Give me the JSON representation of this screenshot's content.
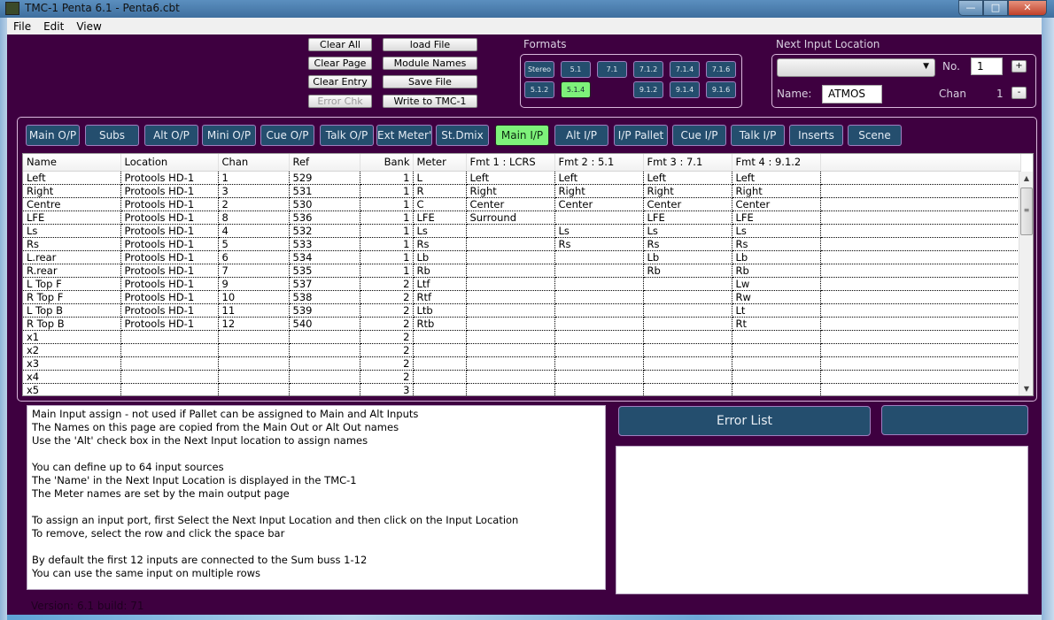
{
  "window": {
    "title": "TMC-1 Penta 6.1 - Penta6.cbt",
    "controls": {
      "minimize": "—",
      "maximize": "□",
      "close": "✕"
    }
  },
  "menu": [
    "File",
    "Edit",
    "View"
  ],
  "actions_left": {
    "clear_all": "Clear All",
    "clear_page": "Clear Page",
    "clear_entry": "Clear Entry",
    "error_chk": "Error Chk"
  },
  "actions_right": {
    "load_file": "load File",
    "module_names": "Module Names",
    "save_file": "Save File",
    "write_tmc": "Write to TMC-1"
  },
  "formats": {
    "label": "Formats",
    "row1": [
      "Stereo",
      "5.1",
      "7.1",
      "7.1.2",
      "7.1.4",
      "7.1.6"
    ],
    "row2": [
      "5.1.2",
      "5.1.4",
      "",
      "9.1.2",
      "9.1.4",
      "9.1.6"
    ],
    "active": "5.1.4"
  },
  "next_input": {
    "label": "Next Input Location",
    "location_value": "",
    "no_label": "No.",
    "no_value": "1",
    "plus": "+",
    "name_label": "Name:",
    "name_value": "ATMOS",
    "chan_label": "Chan",
    "chan_value": "1",
    "minus": "-"
  },
  "tabs": [
    "Main O/P",
    "Subs",
    "Alt O/P",
    "Mini O/P",
    "Cue O/P",
    "Talk O/P",
    "Ext Meter's",
    "St.Dmix",
    "Main I/P",
    "Alt I/P",
    "I/P Pallet",
    "Cue I/P",
    "Talk I/P",
    "Inserts",
    "Scene"
  ],
  "active_tab": "Main I/P",
  "grid": {
    "columns": [
      "Name",
      "Location",
      "Chan",
      "Ref",
      "Bank",
      "Meter",
      "Fmt 1 : LCRS",
      "Fmt 2 : 5.1",
      "Fmt 3 : 7.1",
      "Fmt 4 : 9.1.2",
      ""
    ],
    "rows": [
      [
        "Left",
        "Protools HD-1",
        "1",
        "529",
        "1",
        "L",
        "Left",
        "Left",
        "Left",
        "Left",
        ""
      ],
      [
        "Right",
        "Protools HD-1",
        "3",
        "531",
        "1",
        "R",
        "Right",
        "Right",
        "Right",
        "Right",
        ""
      ],
      [
        "Centre",
        "Protools HD-1",
        "2",
        "530",
        "1",
        "C",
        "Center",
        "Center",
        "Center",
        "Center",
        ""
      ],
      [
        "LFE",
        "Protools HD-1",
        "8",
        "536",
        "1",
        "LFE",
        "Surround",
        "",
        "LFE",
        "LFE",
        ""
      ],
      [
        "Ls",
        "Protools HD-1",
        "4",
        "532",
        "1",
        "Ls",
        "",
        "Ls",
        "Ls",
        "Ls",
        ""
      ],
      [
        "Rs",
        "Protools HD-1",
        "5",
        "533",
        "1",
        "Rs",
        "",
        "Rs",
        "Rs",
        "Rs",
        ""
      ],
      [
        "L.rear",
        "Protools HD-1",
        "6",
        "534",
        "1",
        "Lb",
        "",
        "",
        "Lb",
        "Lb",
        ""
      ],
      [
        "R.rear",
        "Protools HD-1",
        "7",
        "535",
        "1",
        "Rb",
        "",
        "",
        "Rb",
        "Rb",
        ""
      ],
      [
        "L Top F",
        "Protools HD-1",
        "9",
        "537",
        "2",
        "Ltf",
        "",
        "",
        "",
        "Lw",
        ""
      ],
      [
        "R Top F",
        "Protools HD-1",
        "10",
        "538",
        "2",
        "Rtf",
        "",
        "",
        "",
        "Rw",
        ""
      ],
      [
        "L Top B",
        "Protools HD-1",
        "11",
        "539",
        "2",
        "Ltb",
        "",
        "",
        "",
        "Lt",
        ""
      ],
      [
        "R Top B",
        "Protools HD-1",
        "12",
        "540",
        "2",
        "Rtb",
        "",
        "",
        "",
        "Rt",
        ""
      ],
      [
        "x1",
        "",
        "",
        "",
        "2",
        "",
        "",
        "",
        "",
        "",
        ""
      ],
      [
        "x2",
        "",
        "",
        "",
        "2",
        "",
        "",
        "",
        "",
        "",
        ""
      ],
      [
        "x3",
        "",
        "",
        "",
        "2",
        "",
        "",
        "",
        "",
        "",
        ""
      ],
      [
        "x4",
        "",
        "",
        "",
        "2",
        "",
        "",
        "",
        "",
        "",
        ""
      ],
      [
        "x5",
        "",
        "",
        "",
        "3",
        "",
        "",
        "",
        "",
        "",
        ""
      ]
    ]
  },
  "help_lines": [
    "Main Input assign - not used if Pallet can be assigned to Main and Alt Inputs",
    "The Names on this page are copied from the Main Out or Alt Out names",
    "Use the 'Alt' check box in the Next Input location to assign names",
    "",
    "You can define up to 64 input sources",
    "The 'Name' in the Next Input Location is displayed in the TMC-1",
    "The Meter names are set by the main output page",
    "",
    "To assign an input port, first Select the Next Input Location and then click on the Input Location",
    "To remove, select the row and click the space bar",
    "",
    "By default the first 12 inputs are connected to the Sum buss 1-12",
    "You can use the same input on multiple rows"
  ],
  "error_list_label": "Error List",
  "secondary_button_label": "",
  "version": "Version: 6.1 build: 71"
}
